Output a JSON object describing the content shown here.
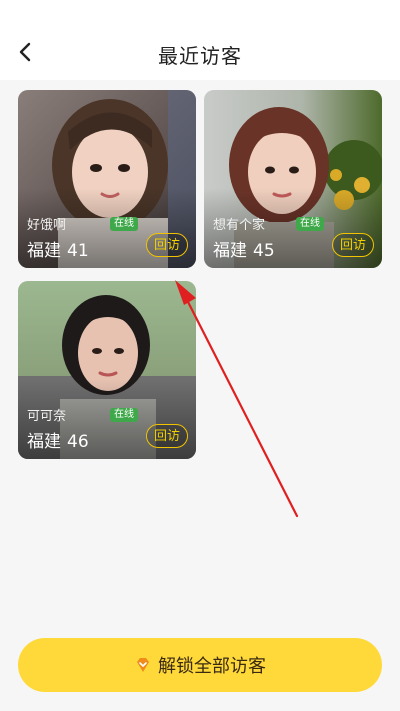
{
  "header": {
    "title": "最近访客"
  },
  "visitors": [
    {
      "nickname": "好饿啊",
      "status": "在线",
      "region": "福建",
      "age": "41",
      "action": "回访"
    },
    {
      "nickname": "想有个家",
      "status": "在线",
      "region": "福建",
      "age": "45",
      "action": "回访"
    },
    {
      "nickname": "可可奈",
      "status": "在线",
      "region": "福建",
      "age": "46",
      "action": "回访"
    }
  ],
  "footer": {
    "unlock_label": "解锁全部访客",
    "icon": "diamond-icon"
  },
  "annotation": {
    "color": "#e02020"
  },
  "colors": {
    "button_yellow": "#ffd93a",
    "revisit_border": "#f2c400",
    "online_green": "#3fa84a"
  }
}
